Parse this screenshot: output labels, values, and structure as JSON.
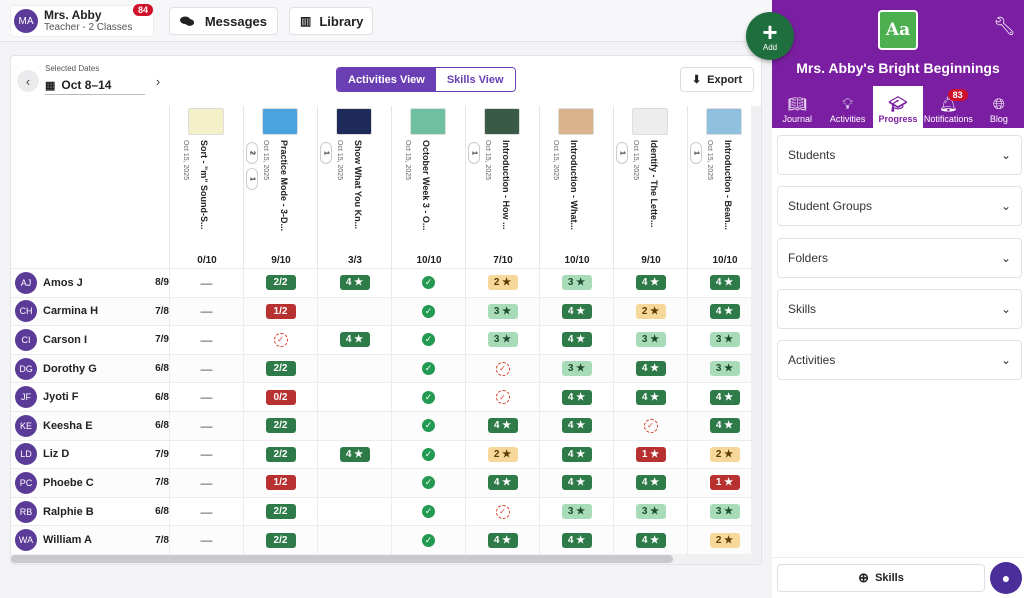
{
  "user": {
    "initials": "MA",
    "name": "Mrs. Abby",
    "subtitle": "Teacher - 2 Classes",
    "badge": "84"
  },
  "nav": {
    "messages": "Messages",
    "library": "Library"
  },
  "dates": {
    "label": "Selected Dates",
    "value": "Oct 8–14"
  },
  "views": {
    "activities": "Activities View",
    "skills": "Skills View"
  },
  "export_label": "Export",
  "add_label": "Add",
  "activities": [
    {
      "title": "Sort - \"m\" Sound-S...",
      "date": "Oct 15, 2025",
      "score": "0/10",
      "chips": [],
      "thumb": "#f4f0c8"
    },
    {
      "title": "Practice Mode - 3-D...",
      "date": "Oct 15, 2025",
      "score": "9/10",
      "chips": [
        "2",
        "1"
      ],
      "thumb": "#4aa3df"
    },
    {
      "title": "Show What You Kn...",
      "date": "Oct 15, 2025",
      "score": "3/3",
      "chips": [
        "1"
      ],
      "thumb": "#1e2a5a"
    },
    {
      "title": "October Week 3 - O...",
      "date": "Oct 15, 2025",
      "score": "10/10",
      "chips": [],
      "thumb": "#6fc0a0"
    },
    {
      "title": "Introduction - How ...",
      "date": "Oct 15, 2025",
      "score": "7/10",
      "chips": [
        "1"
      ],
      "thumb": "#3a5a48"
    },
    {
      "title": "Introduction - What...",
      "date": "Oct 15, 2025",
      "score": "10/10",
      "chips": [],
      "thumb": "#d9b38c"
    },
    {
      "title": "Identify - The Lette...",
      "date": "Oct 15, 2025",
      "score": "9/10",
      "chips": [
        "1"
      ],
      "thumb": "#ededed"
    },
    {
      "title": "Introduction - Bean...",
      "date": "Oct 15, 2025",
      "score": "10/10",
      "chips": [
        "1"
      ],
      "thumb": "#8fc0de"
    }
  ],
  "students": [
    {
      "initials": "AJ",
      "name": "Amos J",
      "score": "8/9",
      "cells": [
        "-",
        "dg:2/2",
        "dg:4 ★",
        "check",
        "yl:2 ★",
        "lg:3 ★",
        "dg:4 ★",
        "dg:4 ★"
      ]
    },
    {
      "initials": "CH",
      "name": "Carmina H",
      "score": "7/8",
      "cells": [
        "-",
        "rd:1/2",
        "",
        "check",
        "lg:3 ★",
        "dg:4 ★",
        "yl:2 ★",
        "dg:4 ★"
      ]
    },
    {
      "initials": "CI",
      "name": "Carson I",
      "score": "7/9",
      "cells": [
        "-",
        "dashed",
        "dg:4 ★",
        "check",
        "lg:3 ★",
        "dg:4 ★",
        "lg:3 ★",
        "lg:3 ★"
      ]
    },
    {
      "initials": "DG",
      "name": "Dorothy G",
      "score": "6/8",
      "cells": [
        "-",
        "dg:2/2",
        "",
        "check",
        "dashed",
        "lg:3 ★",
        "dg:4 ★",
        "lg:3 ★"
      ]
    },
    {
      "initials": "JF",
      "name": "Jyoti F",
      "score": "6/8",
      "cells": [
        "-",
        "rd:0/2",
        "",
        "check",
        "dashed",
        "dg:4 ★",
        "dg:4 ★",
        "dg:4 ★"
      ]
    },
    {
      "initials": "KE",
      "name": "Keesha E",
      "score": "6/8",
      "cells": [
        "-",
        "dg:2/2",
        "",
        "check",
        "dg:4 ★",
        "dg:4 ★",
        "dashed",
        "dg:4 ★"
      ]
    },
    {
      "initials": "LD",
      "name": "Liz D",
      "score": "7/9",
      "cells": [
        "-",
        "dg:2/2",
        "dg:4 ★",
        "check",
        "yl:2 ★",
        "dg:4 ★",
        "rd:1 ★",
        "yl:2 ★"
      ]
    },
    {
      "initials": "PC",
      "name": "Phoebe C",
      "score": "7/8",
      "cells": [
        "-",
        "rd:1/2",
        "",
        "check",
        "dg:4 ★",
        "dg:4 ★",
        "dg:4 ★",
        "rd:1 ★"
      ]
    },
    {
      "initials": "RB",
      "name": "Ralphie B",
      "score": "6/8",
      "cells": [
        "-",
        "dg:2/2",
        "",
        "check",
        "dashed",
        "lg:3 ★",
        "lg:3 ★",
        "lg:3 ★"
      ]
    },
    {
      "initials": "WA",
      "name": "William A",
      "score": "7/8",
      "cells": [
        "-",
        "dg:2/2",
        "",
        "check",
        "dg:4 ★",
        "dg:4 ★",
        "dg:4 ★",
        "yl:2 ★"
      ]
    }
  ],
  "sidebar": {
    "class_title": "Mrs. Abby's Bright Beginnings",
    "logo_text": "Aa",
    "tabs": [
      {
        "label": "Journal",
        "icon": "book-icon"
      },
      {
        "label": "Activities",
        "icon": "lightbulb-icon"
      },
      {
        "label": "Progress",
        "icon": "graduation-cap-icon"
      },
      {
        "label": "Notifications",
        "icon": "bell-icon",
        "badge": "83"
      },
      {
        "label": "Blog",
        "icon": "globe-icon"
      }
    ],
    "sections": [
      "Students",
      "Student Groups",
      "Folders",
      "Skills",
      "Activities"
    ],
    "bottom_button": "Skills"
  },
  "colors": {
    "brand_purple": "#7b1fa2",
    "view_purple": "#6a3fb4",
    "add_green": "#1f6e3e"
  }
}
